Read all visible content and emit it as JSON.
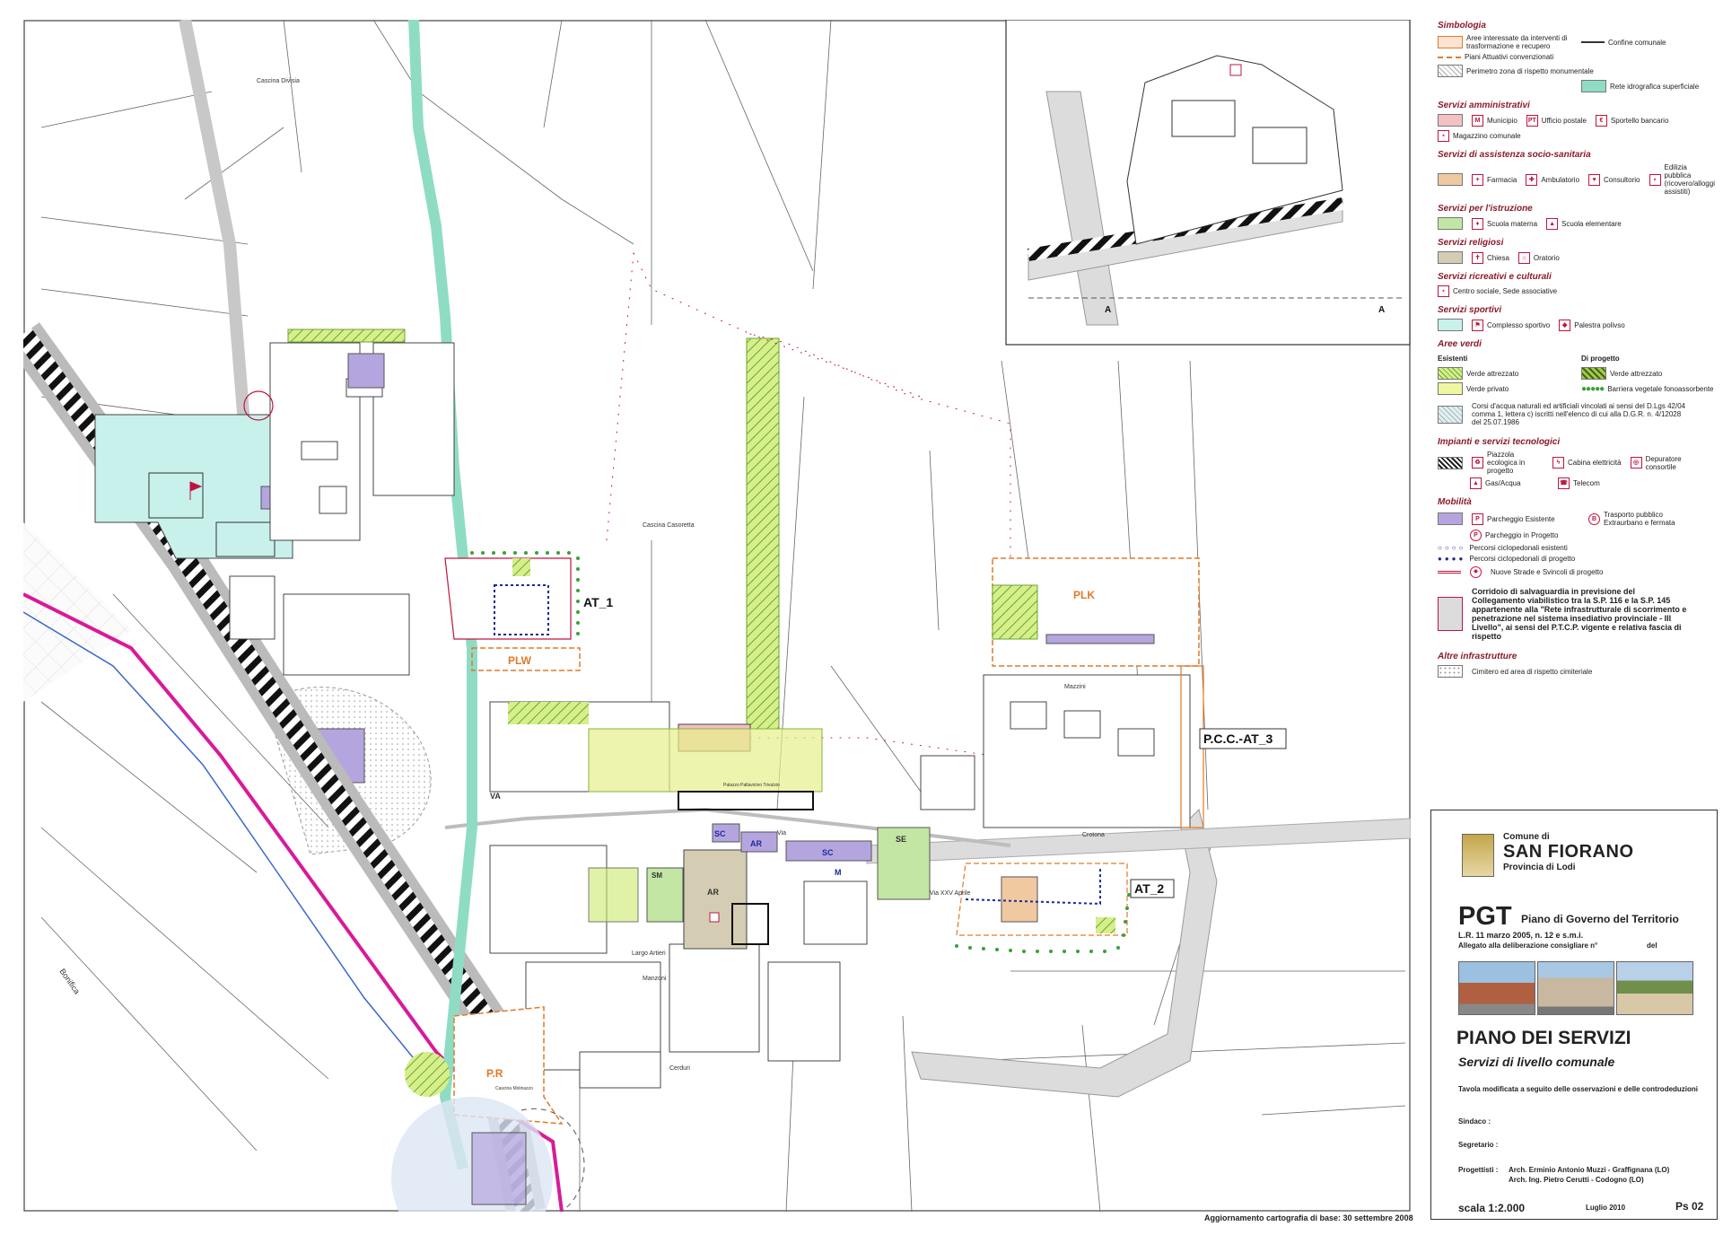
{
  "colors": {
    "amministrativi": "#f3c0c4",
    "sanitaria": "#f1c9a1",
    "istruzione": "#c3e6a4",
    "religiosi": "#d4cdb4",
    "sportivi": "#c8f1ec",
    "verde": "#c9e96e",
    "parcheggio": "#b5a5de",
    "rete_idrografica": "#8fdcc4",
    "perimetro_piani": "#e07a2a",
    "icon_red": "#c0143c",
    "corridoio": "#dcdcdc"
  },
  "legend": {
    "simbologia": {
      "title": "Simbologia",
      "aree": "Aree interessate da interventi di trasformazione e recupero",
      "piani": "Piani Attuativi convenzionati",
      "confine": "Confine comunale",
      "perimetro": "Perimetro zona di rispetto monumentale",
      "rete": "Rete idrografica superficiale"
    },
    "amministrativi": {
      "title": "Servizi amministrativi",
      "items": [
        "Municipio",
        "Ufficio postale",
        "Sportello bancario",
        "Magazzino comunale"
      ]
    },
    "sanitaria": {
      "title": "Servizi di assistenza socio-sanitaria",
      "items": [
        "Farmacia",
        "Ambulatorio",
        "Consultorio",
        "Edilizia pubblica (ricovero/alloggi assistiti)"
      ]
    },
    "istruzione": {
      "title": "Servizi per l'istruzione",
      "items": [
        "Scuola materna",
        "Scuola elementare"
      ]
    },
    "religiosi": {
      "title": "Servizi religiosi",
      "items": [
        "Chiesa",
        "Oratorio"
      ]
    },
    "culturali": {
      "title": "Servizi ricreativi e culturali",
      "items": [
        "Centro sociale, Sede associative"
      ]
    },
    "sportivi": {
      "title": "Servizi sportivi",
      "items": [
        "Complesso sportivo",
        "Palestra polivso"
      ]
    },
    "verdi": {
      "title": "Aree verdi",
      "esistenti": "Esistenti",
      "progetto": "Di progetto",
      "items": [
        "Verde attrezzato",
        "Verde privato",
        "Verde attrezzato",
        "Barriera vegetale fonoassorbente"
      ],
      "corsi": "Corsi d'acqua naturali ed artificiali vincolati ai sensi del D.Lgs 42/04 comma 1, lettera c) iscritti nell'elenco di cui alla D.G.R. n. 4/12028 del 25.07.1986"
    },
    "impianti": {
      "title": "Impianti e servizi tecnologici",
      "items": [
        "Piazzola ecologica in progetto",
        "Cabina elettricità",
        "Depuratore consortile",
        "Gas/Acqua",
        "Telecom"
      ]
    },
    "mobilita": {
      "title": "Mobilità",
      "items": [
        "Parcheggio Esistente",
        "Parcheggio in Progetto",
        "Trasporto pubblico Extraurbano e fermata",
        "Percorsi ciclopedonali esistenti",
        "Percorsi ciclopedonali di progetto",
        "Nuove Strade e Svincoli di progetto"
      ],
      "corridoio": "Corridoio di salvaguardia in previsione del Collegamento viabilistico tra la S.P. 116 e la S.P. 145 appartenente alla \"Rete infrastrutturale di scorrimento e penetrazione nel sistema insediativo provinciale - III Livello\", ai sensi del P.T.C.P. vigente e relativa fascia di rispetto"
    },
    "altre": {
      "title": "Altre infrastrutture",
      "items": [
        "Cimitero ed area di rispetto cimiteriale"
      ]
    }
  },
  "map": {
    "labels": {
      "at1": "AT_1",
      "at2": "AT_2",
      "at3": "P.C.C.-AT_3",
      "plw": "PLW",
      "plk": "PLK",
      "pr": "P.R",
      "ar1": "AR",
      "ar2": "AR",
      "sc1": "SC",
      "sc2": "SC",
      "se": "SE",
      "m": "M",
      "va": "VA",
      "sm": "SM",
      "palazzo": "Palazzo Pallavicino Trivulzio",
      "cascina_casoretta": "Cascina Casoretta",
      "cascina_molinazzo": "Cascina Molinazzo",
      "cascina_divisia": "Cascina Divisia",
      "bonifica": "Bonifica",
      "crotona": "Crotona",
      "via_mazzini": "Mazzini",
      "via_manzoni": "Manzoni",
      "via_cerduri": "Cerduri",
      "largo_artieri": "Largo Artieri",
      "via_xxv_aprile": "Via XXV Aprile",
      "via_roma": "Via",
      "inset_a1": "A",
      "inset_a2": "A"
    },
    "update": "Aggiornamento cartografia di base: 30 settembre 2008"
  },
  "titleblock": {
    "comune_di": "Comune di",
    "comune": "SAN FIORANO",
    "provincia": "Provincia di Lodi",
    "pgt": "PGT",
    "pgt_full": "Piano di Governo del Territorio",
    "lr": "L.R. 11 marzo 2005, n. 12 e s.m.i.",
    "allegato": "Allegato alla deliberazione consigliare n°",
    "del": "del",
    "title": "PIANO DEI SERVIZI",
    "subtitle": "Servizi di livello comunale",
    "note": "Tavola modificata a seguito delle osservazioni e delle controdeduzioni",
    "sindaco": "Sindaco :",
    "segretario": "Segretario :",
    "progettisti": "Progettisti :",
    "prog1": "Arch. Erminio Antonio Muzzi - Graffignana (LO)",
    "prog2": "Arch. Ing. Pietro Cerutti - Codogno (LO)",
    "scala": "scala 1:2.000",
    "data": "Luglio 2010",
    "tavola": "Ps 02"
  }
}
